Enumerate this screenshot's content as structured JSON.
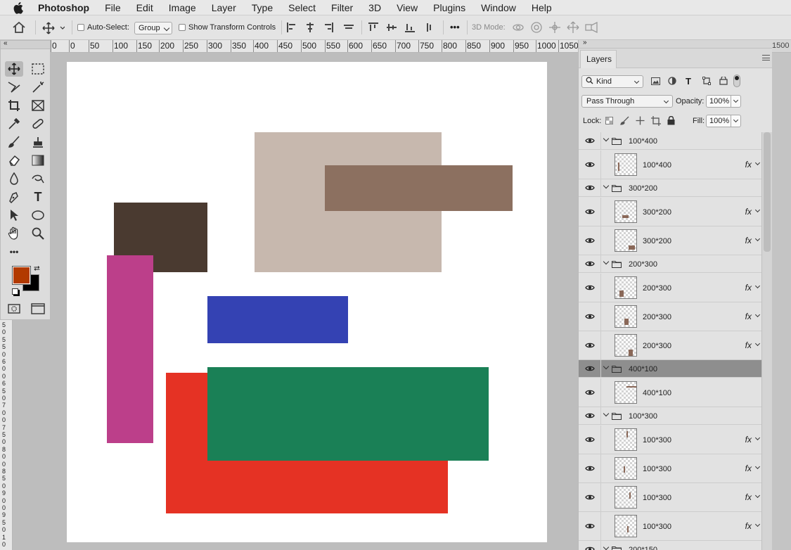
{
  "menubar": {
    "app": "Photoshop",
    "items": [
      "File",
      "Edit",
      "Image",
      "Layer",
      "Type",
      "Select",
      "Filter",
      "3D",
      "View",
      "Plugins",
      "Window",
      "Help"
    ]
  },
  "options_bar": {
    "auto_select_label": "Auto-Select:",
    "auto_select_checked": false,
    "auto_select_value": "Group",
    "show_transform_label": "Show Transform Controls",
    "show_transform_checked": false,
    "mode_3d_label": "3D Mode:"
  },
  "ruler": {
    "h_labels": [
      "0",
      "0",
      "50",
      "100",
      "150",
      "200",
      "250",
      "300",
      "350",
      "400",
      "450",
      "500",
      "550",
      "600",
      "650",
      "700",
      "750",
      "800",
      "850",
      "900",
      "950",
      "1000",
      "1050"
    ],
    "far_right_label": "1500",
    "v_labels": [
      "5",
      "0",
      "5",
      "5",
      "0",
      "6",
      "0",
      "0",
      "6",
      "5",
      "0",
      "7",
      "0",
      "0",
      "7",
      "5",
      "0",
      "8",
      "0",
      "0",
      "8",
      "5",
      "0",
      "9",
      "0",
      "0",
      "9",
      "5",
      "0",
      "1",
      "0"
    ]
  },
  "canvas": {
    "background": "#ffffff",
    "shapes": [
      {
        "name": "rect-beige",
        "color": "#c7b8ae"
      },
      {
        "name": "rect-mocha",
        "color": "#8c7060"
      },
      {
        "name": "rect-dark-brown",
        "color": "#4a3a30"
      },
      {
        "name": "rect-magenta",
        "color": "#bc3f8a"
      },
      {
        "name": "rect-blue",
        "color": "#3442b3"
      },
      {
        "name": "rect-red",
        "color": "#e53224"
      },
      {
        "name": "rect-green",
        "color": "#1a8056"
      }
    ]
  },
  "tools": {
    "foreground_color": "#b23a00",
    "background_color": "#000000",
    "items": [
      "move-tool",
      "marquee-tool",
      "lasso-tool",
      "magic-wand-tool",
      "crop-tool",
      "frame-tool",
      "eyedropper-tool",
      "healing-brush-tool",
      "brush-tool",
      "clone-stamp-tool",
      "eraser-tool",
      "gradient-tool",
      "blur-tool",
      "dodge-tool",
      "pen-tool",
      "type-tool",
      "path-selection-tool",
      "ellipse-tool",
      "hand-tool",
      "zoom-tool",
      "more-tools",
      "quick-mask",
      "screen-mode"
    ],
    "type_glyph": "T",
    "more_glyph": "•••"
  },
  "layers_panel": {
    "title": "Layers",
    "filter_kind": "Kind",
    "blend_mode": "Pass Through",
    "opacity_label": "Opacity:",
    "opacity_value": "100%",
    "lock_label": "Lock:",
    "fill_label": "Fill:",
    "fill_value": "100%",
    "fx_label": "fx",
    "rows": [
      {
        "type": "group",
        "name": "100*400"
      },
      {
        "type": "layer",
        "name": "100*400",
        "fx": true
      },
      {
        "type": "group",
        "name": "300*200"
      },
      {
        "type": "layer",
        "name": "300*200",
        "fx": true
      },
      {
        "type": "layer",
        "name": "300*200",
        "fx": true
      },
      {
        "type": "group",
        "name": "200*300"
      },
      {
        "type": "layer",
        "name": "200*300",
        "fx": true
      },
      {
        "type": "layer",
        "name": "200*300",
        "fx": true
      },
      {
        "type": "layer",
        "name": "200*300",
        "fx": true
      },
      {
        "type": "group",
        "name": "400*100",
        "selected": true
      },
      {
        "type": "layer",
        "name": "400*100",
        "fx": false
      },
      {
        "type": "group",
        "name": "100*300"
      },
      {
        "type": "layer",
        "name": "100*300",
        "fx": true
      },
      {
        "type": "layer",
        "name": "100*300",
        "fx": true
      },
      {
        "type": "layer",
        "name": "100*300",
        "fx": true
      },
      {
        "type": "layer",
        "name": "100*300",
        "fx": true
      },
      {
        "type": "group",
        "name": "200*150"
      }
    ]
  }
}
